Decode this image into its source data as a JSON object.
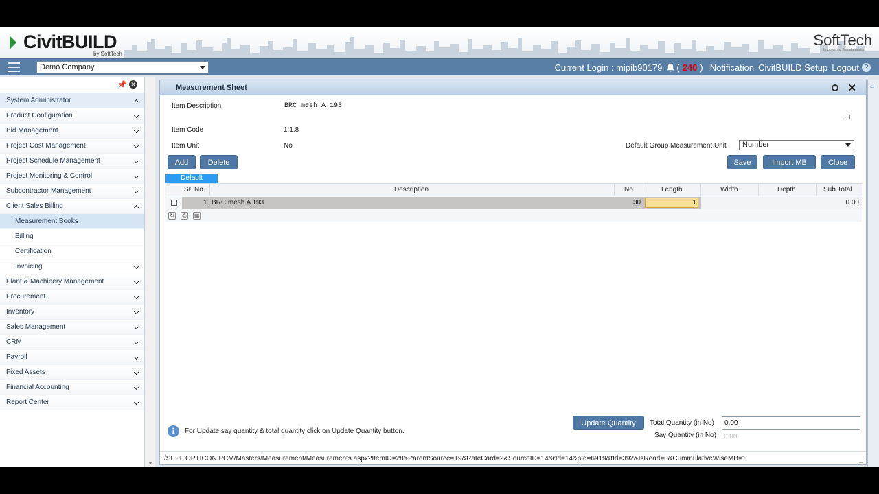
{
  "app": {
    "logo": "CivitBUILD",
    "logo_by": "by SoftTech",
    "brand_right": "SoftTech",
    "brand_tagline": "Empowering Transformation"
  },
  "topbar": {
    "company": "Demo Company",
    "login_label": "Current Login : mipib90179",
    "notif_open": "(",
    "notif_count": "240",
    "notif_close": ")",
    "notification": "Notification",
    "setup": "CivitBUILD Setup",
    "logout": "Logout",
    "help_icon": "?"
  },
  "sidebar": {
    "items": [
      {
        "label": "System Administrator"
      },
      {
        "label": "Product Configuration"
      },
      {
        "label": "Bid Management"
      },
      {
        "label": "Project Cost Management"
      },
      {
        "label": "Project Schedule Management"
      },
      {
        "label": "Project Monitoring & Control"
      },
      {
        "label": "Subcontractor Management"
      },
      {
        "label": "Client Sales Billing"
      },
      {
        "label": "Measurement Books"
      },
      {
        "label": "Billing"
      },
      {
        "label": "Certification"
      },
      {
        "label": "Invoicing"
      },
      {
        "label": "Plant & Machinery Management"
      },
      {
        "label": "Procurement"
      },
      {
        "label": "Inventory"
      },
      {
        "label": "Sales Management"
      },
      {
        "label": "CRM"
      },
      {
        "label": "Payroll"
      },
      {
        "label": "Fixed Assets"
      },
      {
        "label": "Financial Accounting"
      },
      {
        "label": "Report Center"
      }
    ]
  },
  "window": {
    "title": "Measurement Sheet",
    "item_description_label": "Item Description",
    "item_description": "BRC mesh A 193",
    "item_code_label": "Item Code",
    "item_code": "1.1.8",
    "item_unit_label": "Item Unit",
    "item_unit": "No",
    "default_unit_label": "Default Group Measurement Unit",
    "default_unit": "Number",
    "buttons": {
      "add": "Add",
      "delete": "Delete",
      "save": "Save",
      "import": "Import MB",
      "close": "Close",
      "update": "Update Quantity"
    },
    "tab": "Default",
    "columns": {
      "sr": "Sr. No.",
      "description": "Description",
      "no": "No",
      "length": "Length",
      "width": "Width",
      "depth": "Depth",
      "subtotal": "Sub Total"
    },
    "rows": [
      {
        "sr": "1",
        "description": "BRC mesh A 193",
        "no": "30",
        "length": "1",
        "width": "",
        "depth": "",
        "subtotal": "0.00"
      }
    ],
    "info_text": "For Update say quantity & total quantity click on Update Quantity button.",
    "total_qty_label": "Total Quantity (in No)",
    "total_qty": "0.00",
    "say_qty_label": "Say Quantity (in No)",
    "say_qty": "0.00",
    "status_url": "/SEPL.OPTICON.PCM/Masters/Measurement/Measurements.aspx?ItemID=28&ParentSource=19&RateCard=2&SourceID=14&rId=14&pId=6919&tId=392&IsRead=0&CummulativeWiseMB=1"
  }
}
